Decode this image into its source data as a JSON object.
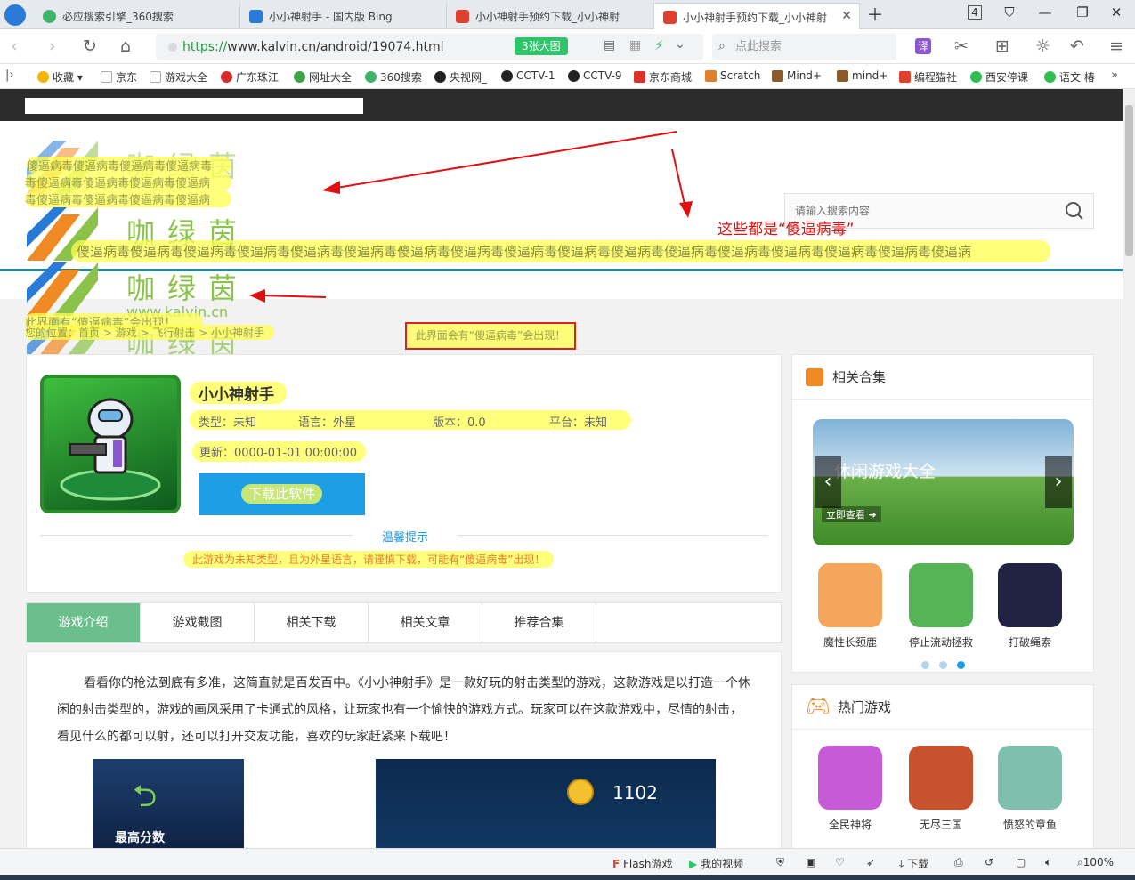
{
  "tabs": [
    {
      "title": "必应搜索引擎_360搜索",
      "color": "#3fb36a"
    },
    {
      "title": "小小神射手 - 国内版 Bing",
      "color": "#2a7bd8"
    },
    {
      "title": "小小神射手预约下载_小小神射",
      "color": "#e0402e"
    },
    {
      "title": "小小神射手预约下载_小小神射",
      "color": "#e0402e"
    }
  ],
  "tab_count": "4",
  "addressbar": {
    "url_proto": "https://",
    "url_host": "www.kalvin.cn/android/19074.html",
    "bigimg_badge": "3张大图",
    "search_placeholder": "点此搜索"
  },
  "bookmarks": [
    {
      "label": "收藏",
      "color": "#f4b400"
    },
    {
      "label": "京东",
      "color": "#dddddd"
    },
    {
      "label": "游戏大全",
      "color": "#dddddd"
    },
    {
      "label": "广东珠江",
      "color": "#d82a2a"
    },
    {
      "label": "网址大全",
      "color": "#3fa34a"
    },
    {
      "label": "360搜索",
      "color": "#3fb36a"
    },
    {
      "label": "央视网_",
      "color": "#222222"
    },
    {
      "label": "CCTV-1",
      "color": "#222222"
    },
    {
      "label": "CCTV-9",
      "color": "#222222"
    },
    {
      "label": "京东商城",
      "color": "#d8322a"
    },
    {
      "label": "Scratch",
      "color": "#e0802e"
    },
    {
      "label": "Mind+",
      "color": "#8a5a2a"
    },
    {
      "label": "mind+",
      "color": "#8a5a2a"
    },
    {
      "label": "编程猫社",
      "color": "#e0402e"
    },
    {
      "label": "西安停课",
      "color": "#2fbf4f"
    },
    {
      "label": "语文 椿",
      "color": "#2fbf4f"
    }
  ],
  "site": {
    "search_placeholder": "请输入搜索内容",
    "logo_text": "咖绿茵",
    "logo_url": "www.kalvin.cn",
    "virus_word": "傻逼病毒",
    "virus_row_1": "傻逼病毒傻逼病毒傻逼病毒傻逼病毒",
    "virus_row_2": "毒傻逼病毒傻逼病毒傻逼病毒傻逼病",
    "virus_row_3": "毒傻逼病毒傻逼病毒傻逼病毒傻逼病",
    "virus_row_long": "傻逼病毒傻逼病毒傻逼病毒傻逼病毒傻逼病毒傻逼病毒傻逼病毒傻逼病毒傻逼病毒傻逼病毒傻逼病毒傻逼病毒傻逼病毒傻逼病毒傻逼病毒傻逼病毒傻逼病",
    "virus_notice_left": "此界面有“傻逼病毒”会出现！",
    "virus_notice_boxed": "此界面会有“傻逼病毒”会出现！",
    "annotation_text": "这些都是“傻逼病毒”",
    "breadcrumb": "您的位置：首页 > 游戏 > 飞行射击 > 小小神射手"
  },
  "game": {
    "name": "小小神射手",
    "type": "类型：未知",
    "lang": "语言：外星",
    "version": "版本：0.0",
    "platform": "平台：未知",
    "updated": "更新：0000-01-01 00:00:00",
    "download": "下载此软件",
    "tip_title": "温馨提示",
    "tip_text": "此游戏为未知类型，且为外星语言，请谨慎下载，可能有“傻逼病毒”出现！"
  },
  "content_tabs": [
    "游戏介绍",
    "游戏截图",
    "相关下载",
    "相关文章",
    "推荐合集"
  ],
  "description": "看看你的枪法到底有多准，这简直就是百发百中。《小小神射手》是一款好玩的射击类型的游戏，这款游戏是以打造一个休闲的射击类型的，游戏的画风采用了卡通式的风格，让玩家也有一个愉快的游戏方式。玩家可以在这款游戏中，尽情的射击，看见什么的都可以射，还可以打开交友功能，喜欢的玩家赶紧来下载吧！",
  "screenshots": {
    "best_score_label": "最高分数",
    "coin_count": "1102"
  },
  "sidebar": {
    "related_title": "相关合集",
    "banner_text": "休闲游戏大全",
    "banner_cta": "立即查看",
    "related_apps": [
      {
        "name": "魔性长颈鹿",
        "color": "#f5a65a"
      },
      {
        "name": "停止流动拯救",
        "color": "#56b356"
      },
      {
        "name": "打破绳索",
        "color": "#222244"
      }
    ],
    "carousel_dots": 3,
    "carousel_active": 3,
    "hot_title": "热门游戏",
    "hot_apps": [
      {
        "name": "全民神将",
        "color": "#c75ad6"
      },
      {
        "name": "无尽三国",
        "color": "#c7532e"
      },
      {
        "name": "愤怒的章鱼",
        "color": "#7fbfae"
      }
    ]
  },
  "statusbar": {
    "flash": "Flash游戏",
    "video": "我的视频",
    "download": "下载",
    "zoom": "100%"
  }
}
